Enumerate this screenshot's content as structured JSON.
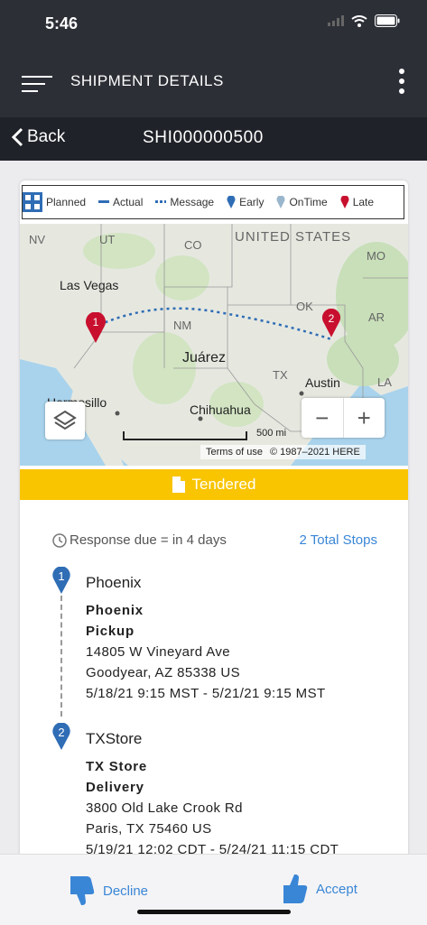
{
  "status_bar": {
    "time": "5:46"
  },
  "header": {
    "title": "SHIPMENT DETAILS"
  },
  "subheader": {
    "back_label": "Back",
    "shipment_id": "SHI000000500"
  },
  "legend": {
    "planned": "Planned",
    "actual": "Actual",
    "message": "Message",
    "early": "Early",
    "ontime": "OnTime",
    "late": "Late"
  },
  "map": {
    "labels": {
      "nv": "NV",
      "ut": "UT",
      "co": "CO",
      "united_states": "UNITED STATES",
      "mo": "MO",
      "las_vegas": "Las Vegas",
      "nm": "NM",
      "ok": "OK",
      "ar": "AR",
      "juarez": "Juárez",
      "tx": "TX",
      "austin": "Austin",
      "la": "LA",
      "hermosillo": "Hermosillo",
      "chihuahua": "Chihuahua"
    },
    "pin1": "1",
    "pin2": "2",
    "zoom_out": "−",
    "zoom_in": "+",
    "scale": "500 mi",
    "terms": "Terms of use",
    "copyright": "© 1987–2021 HERE"
  },
  "status": {
    "label": "Tendered",
    "color": "#f9c400"
  },
  "response": {
    "due": "Response due = in 4 days",
    "total_stops": "2 Total Stops"
  },
  "stops": [
    {
      "number": "1",
      "name": "Phoenix",
      "location": "Phoenix",
      "type": "Pickup",
      "address1": "14805 W Vineyard Ave",
      "address2": "Goodyear, AZ 85338 US",
      "window": "5/18/21 9:15 MST - 5/21/21 9:15 MST"
    },
    {
      "number": "2",
      "name": "TXStore",
      "location": "TX Store",
      "type": "Delivery",
      "address1": "3800 Old Lake Crook Rd",
      "address2": "Paris, TX 75460 US",
      "window": "5/19/21 12:02 CDT - 5/24/21 11:15 CDT"
    }
  ],
  "actions": {
    "decline": "Decline",
    "accept": "Accept"
  },
  "colors": {
    "accent": "#3a86d6",
    "header_bg": "#2c2f36",
    "late_pin": "#c8102e",
    "stop_pin": "#2f6db5"
  }
}
